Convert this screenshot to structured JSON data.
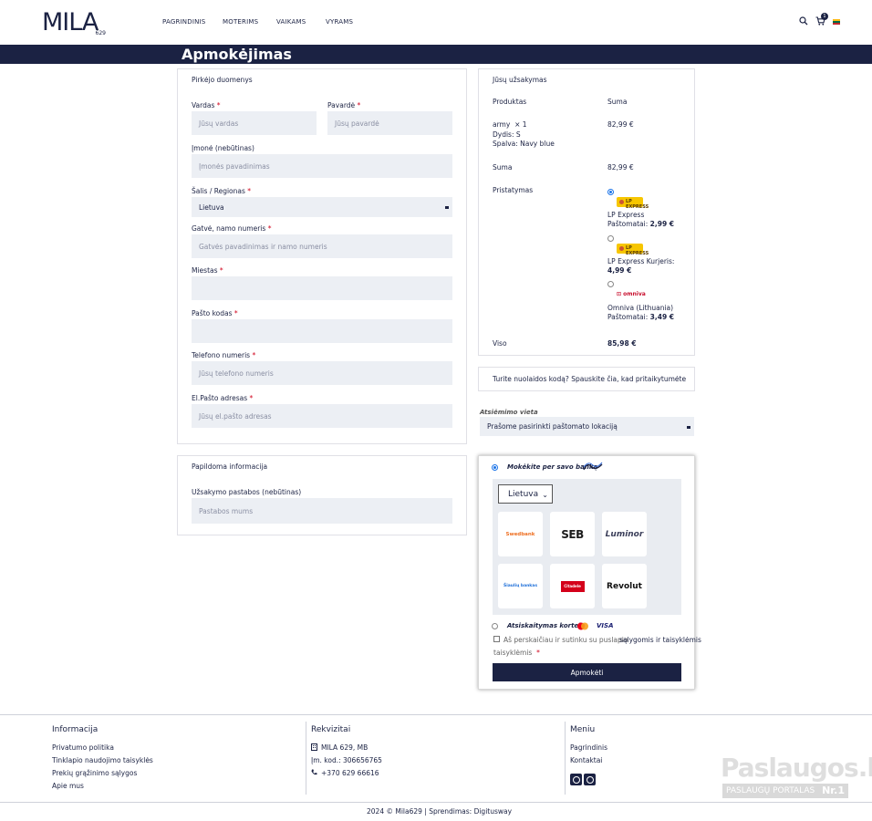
{
  "header": {
    "logo_text": "MILA",
    "logo_sub": "629",
    "nav": [
      "PAGRINDINIS",
      "MOTERIMS",
      "VAIKAMS",
      "VYRAMS"
    ],
    "cart_count": "1"
  },
  "page_title": "Apmokėjimas",
  "billing": {
    "title": "Pirkėjo duomenys",
    "first_name_label": "Vardas",
    "first_name_placeholder": "Jūsų vardas",
    "last_name_label": "Pavardė",
    "last_name_placeholder": "Jūsų pavardė",
    "company_label": "Įmonė (nebūtinas)",
    "company_placeholder": "Įmonės pavadinimas",
    "country_label": "Šalis / Regionas",
    "country_value": "Lietuva",
    "street_label": "Gatvė, namo numeris",
    "street_placeholder": "Gatvės pavadinimas ir namo numeris",
    "city_label": "Miestas",
    "postcode_label": "Pašto kodas",
    "phone_label": "Telefono numeris",
    "phone_placeholder": "Jūsų telefono numeris",
    "email_label": "El.Pašto adresas",
    "email_placeholder": "Jūsų el.pašto adresas",
    "required_mark": "*"
  },
  "additional": {
    "title": "Papildoma informacija",
    "notes_label": "Užsakymo pastabos (nebūtinas)",
    "notes_placeholder": "Pastabos mums"
  },
  "order": {
    "title": "Jūsų užsakymas",
    "col_product": "Produktas",
    "col_sum": "Suma",
    "product_name": "army",
    "product_qty": "× 1",
    "product_size": "Dydis: S",
    "product_color": "Spalva: Navy blue",
    "product_price": "82,99 €",
    "subtotal_label": "Suma",
    "subtotal_value": "82,99 €",
    "shipping_label": "Pristatymas",
    "shipping_options": [
      {
        "logo": "LP EXPRESS",
        "line1": "LP Express",
        "line2": "Paštomatai:",
        "price": "2,99 €",
        "selected": true
      },
      {
        "logo": "LP EXPRESS",
        "line1": "LP Express Kurjeris:",
        "line2": "",
        "price": "4,99 €",
        "selected": false
      },
      {
        "logo": "omniva",
        "line1": "Omniva (Lithuania)",
        "line2": "Paštomatai:",
        "price": "3,49 €",
        "selected": false
      }
    ],
    "total_label": "Viso",
    "total_value": "85,98 €"
  },
  "coupon": {
    "text": "Turite nuolaidos kodą? Spauskite čia, kad pritaikytumėte"
  },
  "pickup": {
    "label": "Atsiėmimo vieta",
    "placeholder": "Prašome pasirinkti paštomato lokaciją"
  },
  "payment": {
    "bank_option": "Mokėkite per savo banką",
    "country": "Lietuva",
    "banks": [
      "Swedbank",
      "SEB",
      "Luminor",
      "Šiaulių bankas",
      "Citadele",
      "Revolut"
    ],
    "card_option": "Atsiskaitymas kortele",
    "card_brand": "VISA",
    "terms_text": "Aš perskaičiau ir sutinku su puslapio",
    "terms_link": "sąlygomis ir taisyklėmis",
    "submit": "Apmokėti"
  },
  "footer": {
    "info_title": "Informacija",
    "info_links": [
      "Privatumo politika",
      "Tinklapio naudojimo taisyklės",
      "Prekių grąžinimo sąlygos",
      "Apie mus"
    ],
    "req_title": "Rekvizitai",
    "company": "MILA 629, MB",
    "company_code": "Įm. kod.: 306656765",
    "phone": "+370 629 66616",
    "menu_title": "Meniu",
    "menu_links": [
      "Pagrindinis",
      "Kontaktai"
    ],
    "copyright": "2024 © Mila629 | Sprendimas: Digitusway"
  },
  "watermark": {
    "main": "Paslaugos.lt",
    "sub": "PASLAUGŲ PORTALAS",
    "badge": "Nr.1"
  },
  "colors": {
    "navy": "#1b2243",
    "field_bg": "#eceff4",
    "required": "#d0021b"
  }
}
